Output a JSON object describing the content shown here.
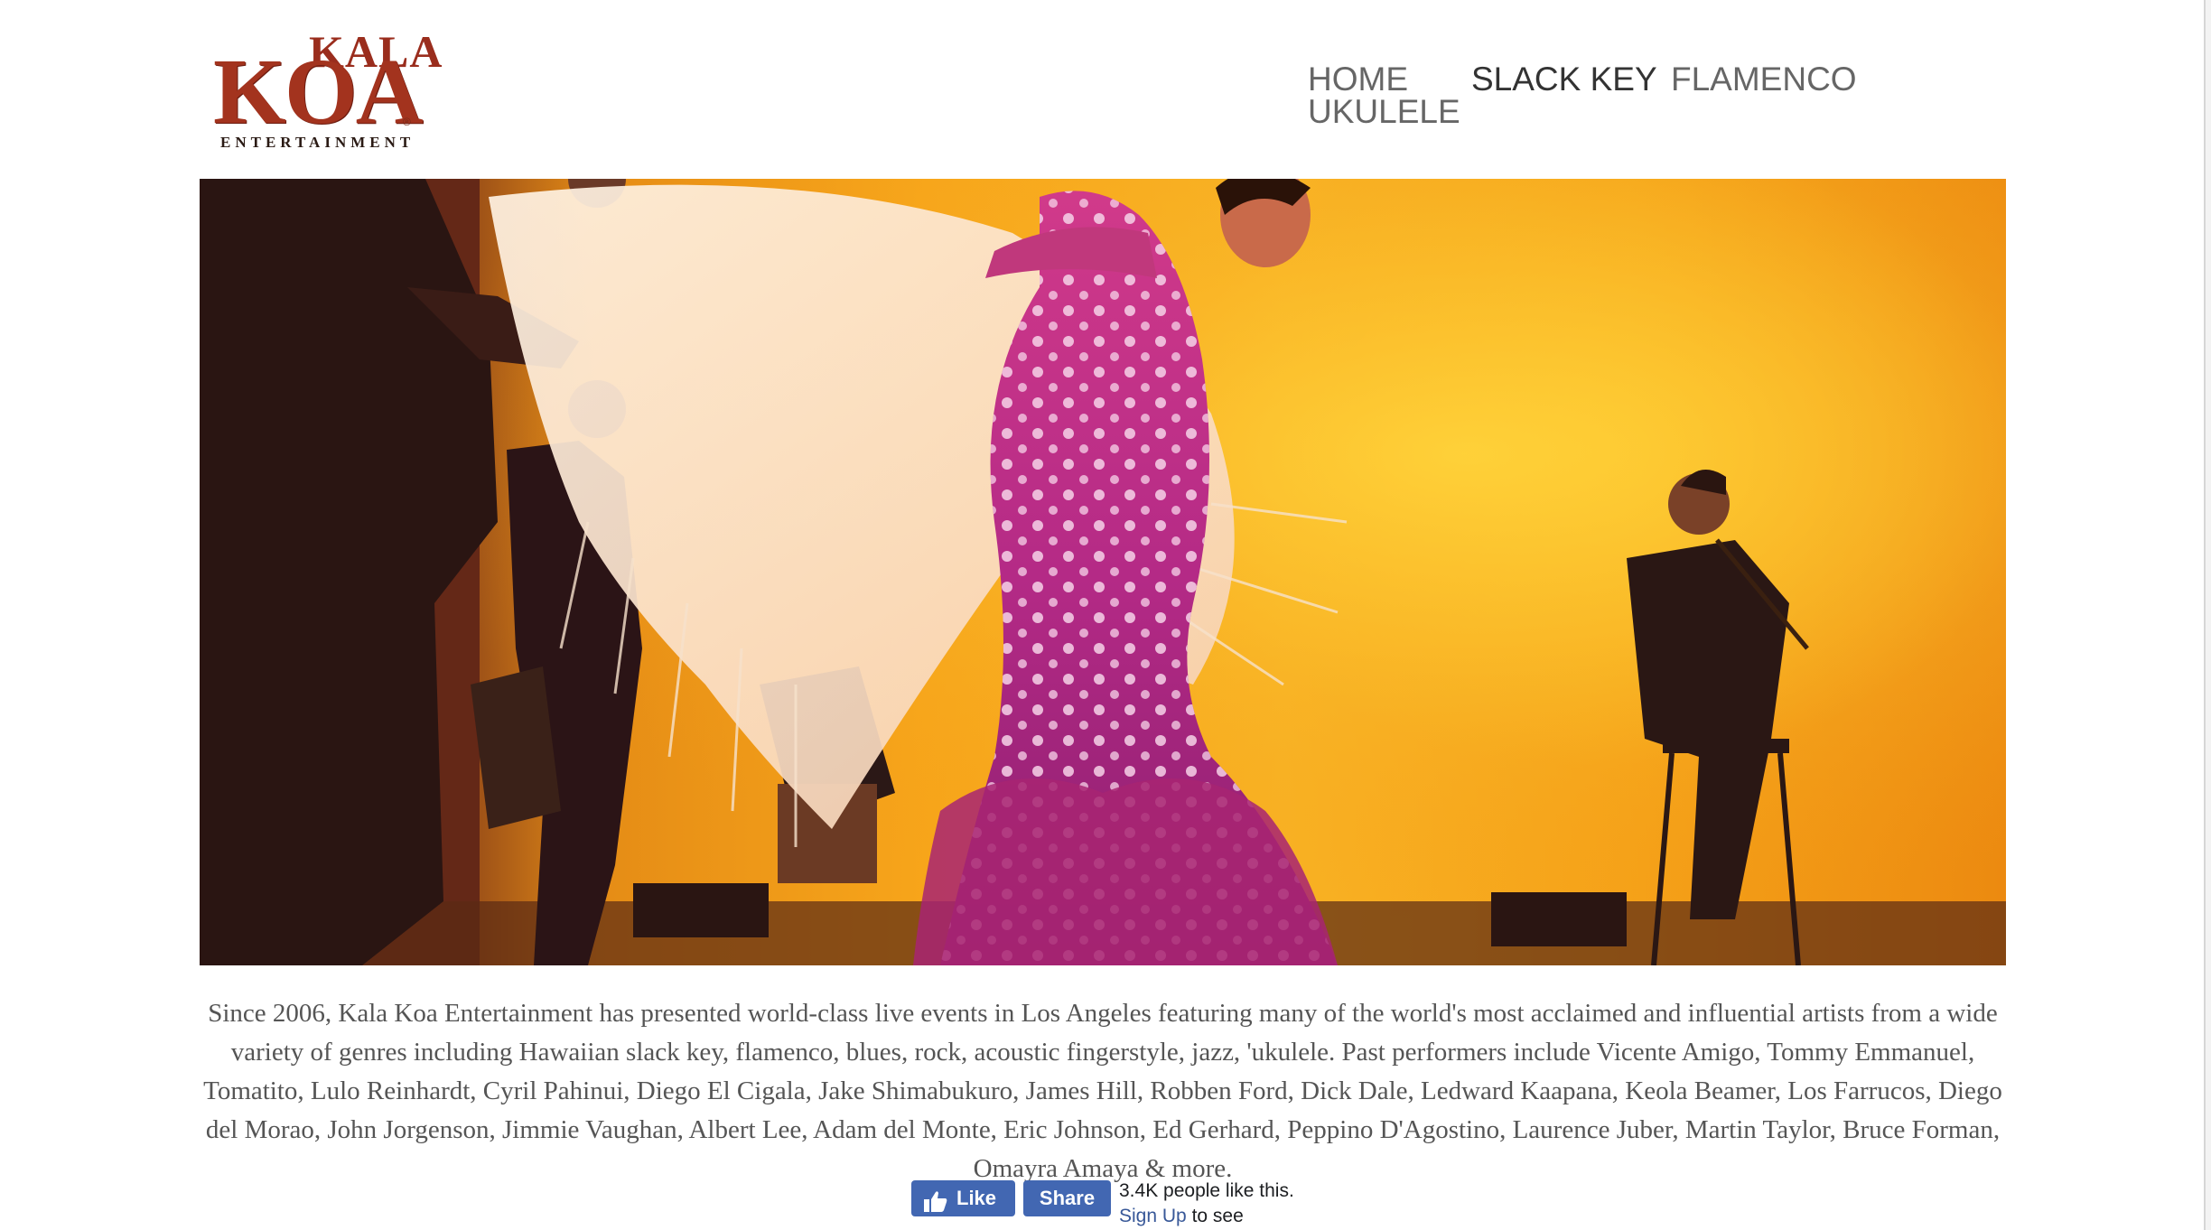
{
  "logo": {
    "kala": "KALA",
    "koa": "KOA",
    "registered": "®",
    "entertainment": "ENTERTAINMENT"
  },
  "nav": {
    "items": [
      {
        "label": "HOME",
        "active": false
      },
      {
        "label": "SLACK KEY",
        "active": true
      },
      {
        "label": "FLAMENCO",
        "active": false
      },
      {
        "label": "UKULELE",
        "active": false
      }
    ]
  },
  "hero": {
    "image": "flamenco-dancer-photo"
  },
  "description": "Since 2006, Kala Koa Entertainment has presented world-class live events in Los Angeles featuring many of the world's most acclaimed and influential artists from a wide variety of genres including Hawaiian slack key, flamenco, blues, rock, acoustic fingerstyle, jazz, 'ukulele. Past performers include Vicente Amigo, Tommy Emmanuel, Tomatito, Lulo Reinhardt, Cyril Pahinui, Diego El Cigala, Jake Shimabukuro, James Hill, Robben Ford, Dick Dale, Ledward Kaapana, Keola Beamer, Los Farrucos, Diego del Morao, John Jorgenson, Jimmie Vaughan, Albert Lee, Adam del Monte, Eric Johnson, Ed Gerhard, Peppino D'Agostino, Laurence Juber, Martin Taylor, Bruce Forman, Omayra Amaya & more.",
  "facebook": {
    "like_label": "Like",
    "share_label": "Share",
    "count_text": "3.4K people like this.",
    "signup_label": "Sign Up",
    "signup_suffix": "to see",
    "brand_color": "#4267b2"
  }
}
